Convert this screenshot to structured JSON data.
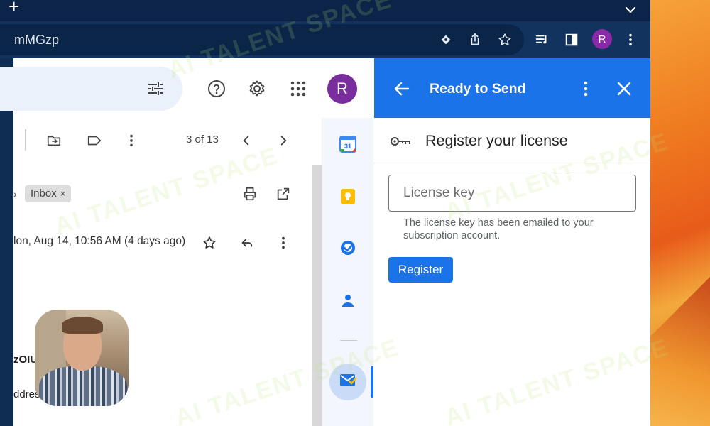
{
  "browser": {
    "new_tab_glyph": "+",
    "url_fragment": "mMGzp",
    "profile_initial": "R"
  },
  "gmail": {
    "avatar_initial": "R",
    "pager": "3 of 13",
    "label_chip": "Inbox",
    "label_chip_remove": "×",
    "message_date": "lon, Aug 14, 10:56 AM (4 days ago)",
    "body_fragment_1": "zOIU",
    "body_fragment_2": "ddres"
  },
  "addon": {
    "header_title": "Ready to Send",
    "section_title": "Register your license",
    "license_placeholder": "License key",
    "license_value": "",
    "hint": "The license key has been emailed to your subscription account.",
    "register_label": "Register"
  },
  "watermark": "AI TALENT SPACE",
  "colors": {
    "panel_header": "#1a73e8",
    "avatar": "#7a2e9e",
    "browser_frame": "#12335d"
  }
}
